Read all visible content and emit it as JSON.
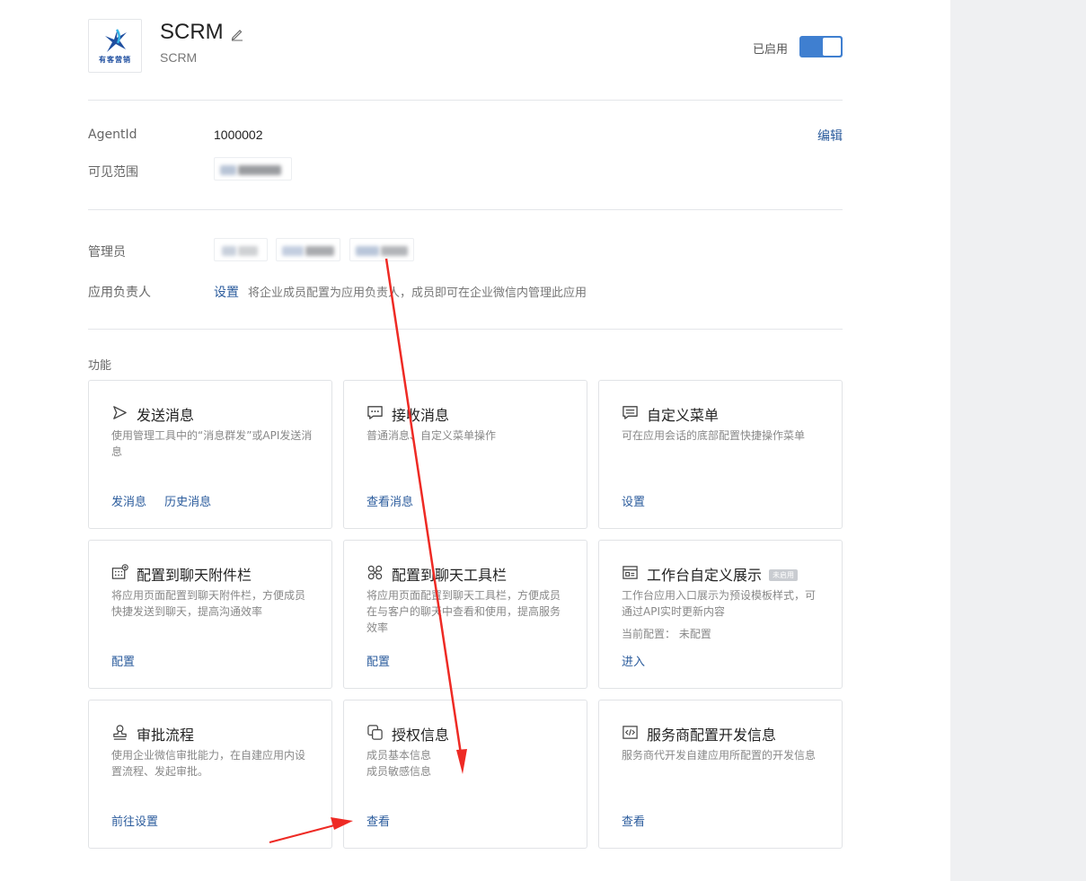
{
  "app": {
    "name": "SCRM",
    "subtitle": "SCRM",
    "logo_text": "有客营销",
    "status_label": "已启用",
    "enabled": true
  },
  "info": {
    "agentid_label": "AgentId",
    "agentid_value": "1000002",
    "edit_label": "编辑",
    "visibility_label": "可见范围",
    "admin_label": "管理员",
    "owner_label": "应用负责人",
    "owner_set_link": "设置",
    "owner_desc": "将企业成员配置为应用负责人，成员即可在企业微信内管理此应用"
  },
  "features": {
    "section_title": "功能",
    "cards": [
      {
        "icon": "send-icon",
        "title": "发送消息",
        "desc": "使用管理工具中的“消息群发”或API发送消息",
        "actions": [
          "发消息",
          "历史消息"
        ]
      },
      {
        "icon": "message-icon",
        "title": "接收消息",
        "desc": "普通消息、自定义菜单操作",
        "actions": [
          "查看消息"
        ]
      },
      {
        "icon": "menu-icon",
        "title": "自定义菜单",
        "desc": "可在应用会话的底部配置快捷操作菜单",
        "actions": [
          "设置"
        ]
      },
      {
        "icon": "attachment-bar-icon",
        "title": "配置到聊天附件栏",
        "desc": "将应用页面配置到聊天附件栏，方便成员快捷发送到聊天，提高沟通效率",
        "actions": [
          "配置"
        ]
      },
      {
        "icon": "toolbar-icon",
        "title": "配置到聊天工具栏",
        "desc": "将应用页面配置到聊天工具栏，方便成员在与客户的聊天中查看和使用，提高服务效率",
        "actions": [
          "配置"
        ]
      },
      {
        "icon": "workbench-icon",
        "title": "工作台自定义展示",
        "badge": "未启用",
        "desc": "工作台应用入口展示为预设模板样式，可通过API实时更新内容",
        "extra": "当前配置： 未配置",
        "actions": [
          "进入"
        ]
      },
      {
        "icon": "approval-icon",
        "title": "审批流程",
        "desc": "使用企业微信审批能力，在自建应用内设置流程、发起审批。",
        "actions": [
          "前往设置"
        ]
      },
      {
        "icon": "authorization-icon",
        "title": "授权信息",
        "desc": "成员基本信息\n成员敏感信息",
        "actions": [
          "查看"
        ]
      },
      {
        "icon": "code-icon",
        "title": "服务商配置开发信息",
        "desc": "服务商代开发自建应用所配置的开发信息",
        "actions": [
          "查看"
        ]
      }
    ]
  },
  "colors": {
    "accent": "#3f7fd0",
    "link": "#2a5b9c",
    "annotation_arrow": "#ee2a24"
  }
}
